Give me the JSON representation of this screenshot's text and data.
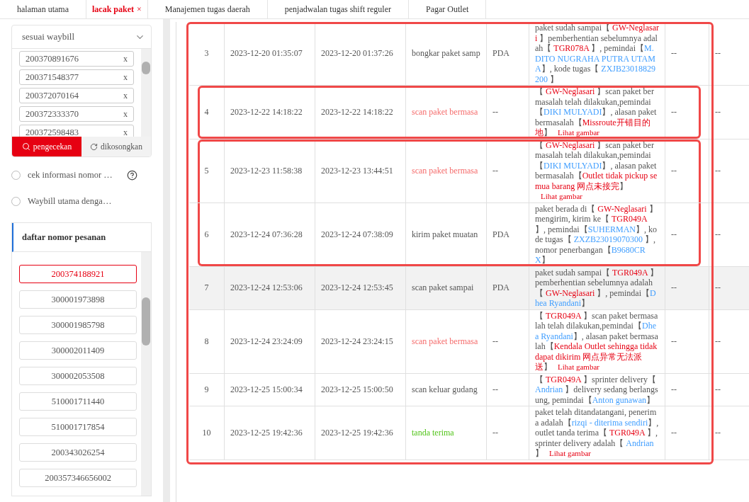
{
  "tabs": [
    {
      "label": "halaman utama",
      "selected": false
    },
    {
      "label": "lacak paket",
      "selected": true,
      "close": "×"
    },
    {
      "label": "Manajemen tugas daerah",
      "selected": false
    },
    {
      "label": "penjadwalan tugas shift reguler",
      "selected": false
    },
    {
      "label": "Pagar Outlet",
      "selected": false
    }
  ],
  "search": {
    "mode": "sesuai waybill",
    "waybills": [
      {
        "number": "200370891676",
        "remove": "x"
      },
      {
        "number": "200371548377",
        "remove": "x"
      },
      {
        "number": "200372070164",
        "remove": "x"
      },
      {
        "number": "200372333370",
        "remove": "x"
      },
      {
        "number": "200372598483",
        "remove": "x"
      }
    ],
    "buttons": [
      {
        "label": "pengecekan",
        "kind": "primary"
      },
      {
        "label": "dikosongkan",
        "kind": "reset"
      }
    ],
    "options": [
      {
        "label": "cek informasi nomor …",
        "selected": false,
        "help": true
      },
      {
        "label": "Waybill utama denga…",
        "selected": false,
        "help": false
      }
    ]
  },
  "order_list": {
    "title": "daftar nomor pesanan",
    "items": [
      {
        "number": "200374188921",
        "selected": true
      },
      {
        "number": "300001973898",
        "selected": false
      },
      {
        "number": "300001985798",
        "selected": false
      },
      {
        "number": "300002011409",
        "selected": false
      },
      {
        "number": "300002053508",
        "selected": false
      },
      {
        "number": "510001711440",
        "selected": false
      },
      {
        "number": "510001717854",
        "selected": false
      },
      {
        "number": "200343026254",
        "selected": false
      },
      {
        "number": "200357346656002",
        "selected": false
      }
    ]
  },
  "table": {
    "outlined": true,
    "rows": [
      {
        "no": "3",
        "scan_time": "2023-12-20 01:35:07",
        "upload_time": "2023-12-20 01:37:26",
        "action": "bongkar paket samp",
        "kind": "normal",
        "source": "PDA",
        "hovered": false,
        "framed": false,
        "column_7": "--",
        "column_8": "--",
        "description": [
          {
            "kind": "plain",
            "text": "paket sudah sampai【 "
          },
          {
            "kind": "site",
            "text": "GW-Neglasari"
          },
          {
            "kind": "plain",
            "text": " 】pemberhentian sebelumnya adalah【 "
          },
          {
            "kind": "site",
            "text": "TGR078A"
          },
          {
            "kind": "plain",
            "text": " 】, pemindai【"
          },
          {
            "kind": "person",
            "text": "M. DITO NUGRAHA PUTRA UTAMA"
          },
          {
            "kind": "plain",
            "text": "】, kode tugas【 "
          },
          {
            "kind": "person",
            "text": "ZXJB23018829200"
          },
          {
            "kind": "plain",
            "text": " 】"
          }
        ]
      },
      {
        "no": "4",
        "scan_time": "2023-12-22 14:18:22",
        "upload_time": "2023-12-22 14:18:22",
        "action": "scan paket bermasa",
        "kind": "problem",
        "source": "--",
        "hovered": false,
        "framed": true,
        "frame_start": true,
        "column_7": "--",
        "column_8": "--",
        "description": [
          {
            "kind": "plain",
            "text": "【 "
          },
          {
            "kind": "site",
            "text": "GW-Neglasari"
          },
          {
            "kind": "plain",
            "text": " 】scan paket bermasalah telah dilakukan,pemindai【"
          },
          {
            "kind": "person",
            "text": "DIKI MULYADI"
          },
          {
            "kind": "plain",
            "text": "】, alasan paket bermasalah【"
          },
          {
            "kind": "site",
            "text": "Missroute开错目的地"
          },
          {
            "kind": "plain",
            "text": "】"
          },
          {
            "kind": "link",
            "text": "Lihat gambar"
          }
        ]
      },
      {
        "no": "5",
        "scan_time": "2023-12-23 11:58:38",
        "upload_time": "2023-12-23 13:44:51",
        "action": "scan paket bermasa",
        "kind": "problem",
        "source": "--",
        "hovered": false,
        "framed": true,
        "frame_start": true,
        "column_7": "--",
        "column_8": "--",
        "description": [
          {
            "kind": "plain",
            "text": "【 "
          },
          {
            "kind": "site",
            "text": "GW-Neglasari"
          },
          {
            "kind": "plain",
            "text": " 】scan paket bermasalah telah dilakukan,pemindai【"
          },
          {
            "kind": "person",
            "text": "DIKI MULYADI"
          },
          {
            "kind": "plain",
            "text": "】, alasan paket bermasalah【"
          },
          {
            "kind": "site",
            "text": "Outlet tidak pickup semua barang 网点未接完"
          },
          {
            "kind": "plain",
            "text": "】"
          },
          {
            "kind": "link",
            "text": "Lihat gambar"
          }
        ]
      },
      {
        "no": "6",
        "scan_time": "2023-12-24 07:36:28",
        "upload_time": "2023-12-24 07:38:09",
        "action": "kirim paket muatan",
        "kind": "normal",
        "source": "PDA",
        "hovered": false,
        "framed": true,
        "frame_start": false,
        "column_7": "--",
        "column_8": "--",
        "description": [
          {
            "kind": "plain",
            "text": "paket berada di【 "
          },
          {
            "kind": "site",
            "text": "GW-Neglasari"
          },
          {
            "kind": "plain",
            "text": " 】mengirim, kirim ke【 "
          },
          {
            "kind": "site",
            "text": "TGR049A"
          },
          {
            "kind": "plain",
            "text": " 】, pemindai【"
          },
          {
            "kind": "person",
            "text": "SUHERMAN"
          },
          {
            "kind": "plain",
            "text": "】, kode tugas【 "
          },
          {
            "kind": "person",
            "text": "ZXZB23019070300"
          },
          {
            "kind": "plain",
            "text": " 】, nomor penerbangan【"
          },
          {
            "kind": "person",
            "text": "B9680CRX"
          },
          {
            "kind": "plain",
            "text": "】"
          }
        ]
      },
      {
        "no": "7",
        "scan_time": "2023-12-24 12:53:06",
        "upload_time": "2023-12-24 12:53:45",
        "action": "scan paket sampai",
        "kind": "normal",
        "source": "PDA",
        "hovered": true,
        "framed": false,
        "column_7": "--",
        "column_8": "--",
        "description": [
          {
            "kind": "plain",
            "text": "paket sudah sampai【 "
          },
          {
            "kind": "site",
            "text": "TGR049A"
          },
          {
            "kind": "plain",
            "text": " 】pemberhentian sebelumnya adalah【 "
          },
          {
            "kind": "site",
            "text": "GW-Neglasari"
          },
          {
            "kind": "plain",
            "text": " 】, pemindai【"
          },
          {
            "kind": "person",
            "text": "Dhea Ryandani"
          },
          {
            "kind": "plain",
            "text": "】"
          }
        ]
      },
      {
        "no": "8",
        "scan_time": "2023-12-24 23:24:09",
        "upload_time": "2023-12-24 23:24:15",
        "action": "scan paket bermasa",
        "kind": "problem",
        "source": "--",
        "hovered": false,
        "framed": false,
        "column_7": "--",
        "column_8": "--",
        "description": [
          {
            "kind": "plain",
            "text": "【 "
          },
          {
            "kind": "site",
            "text": "TGR049A"
          },
          {
            "kind": "plain",
            "text": " 】scan paket bermasalah telah dilakukan,pemindai【"
          },
          {
            "kind": "person",
            "text": "Dhea Ryandani"
          },
          {
            "kind": "plain",
            "text": "】, alasan paket bermasalah【"
          },
          {
            "kind": "site",
            "text": "Kendala Outlet sehingga tidak dapat dikirim 网点异常无法派送"
          },
          {
            "kind": "plain",
            "text": "】"
          },
          {
            "kind": "link",
            "text": "Lihat gambar"
          }
        ]
      },
      {
        "no": "9",
        "scan_time": "2023-12-25 15:00:34",
        "upload_time": "2023-12-25 15:00:50",
        "action": "scan keluar gudang",
        "kind": "normal",
        "source": "--",
        "hovered": false,
        "framed": false,
        "column_7": "--",
        "column_8": "--",
        "description": [
          {
            "kind": "plain",
            "text": "【 "
          },
          {
            "kind": "site",
            "text": "TGR049A"
          },
          {
            "kind": "plain",
            "text": " 】sprinter delivery【 "
          },
          {
            "kind": "person",
            "text": "Andrian"
          },
          {
            "kind": "plain",
            "text": " 】delivery sedang berlangsung, pemindai【"
          },
          {
            "kind": "person",
            "text": "Anton gunawan"
          },
          {
            "kind": "plain",
            "text": "】"
          }
        ]
      },
      {
        "no": "10",
        "scan_time": "2023-12-25 19:42:36",
        "upload_time": "2023-12-25 19:42:36",
        "action": "tanda terima",
        "kind": "signed",
        "source": "--",
        "hovered": false,
        "framed": false,
        "column_7": "--",
        "column_8": "--",
        "description": [
          {
            "kind": "plain",
            "text": "paket telah ditandatangani, penerima adalah【"
          },
          {
            "kind": "person",
            "text": "rizqi - diterima sendiri"
          },
          {
            "kind": "plain",
            "text": "】, outlet tanda terima【 "
          },
          {
            "kind": "site",
            "text": "TGR049A"
          },
          {
            "kind": "plain",
            "text": " 】, sprinter delivery adalah【 "
          },
          {
            "kind": "person",
            "text": "Andrian"
          },
          {
            "kind": "plain",
            "text": " 】"
          },
          {
            "kind": "link",
            "text": "Lihat gambar"
          }
        ]
      }
    ]
  }
}
